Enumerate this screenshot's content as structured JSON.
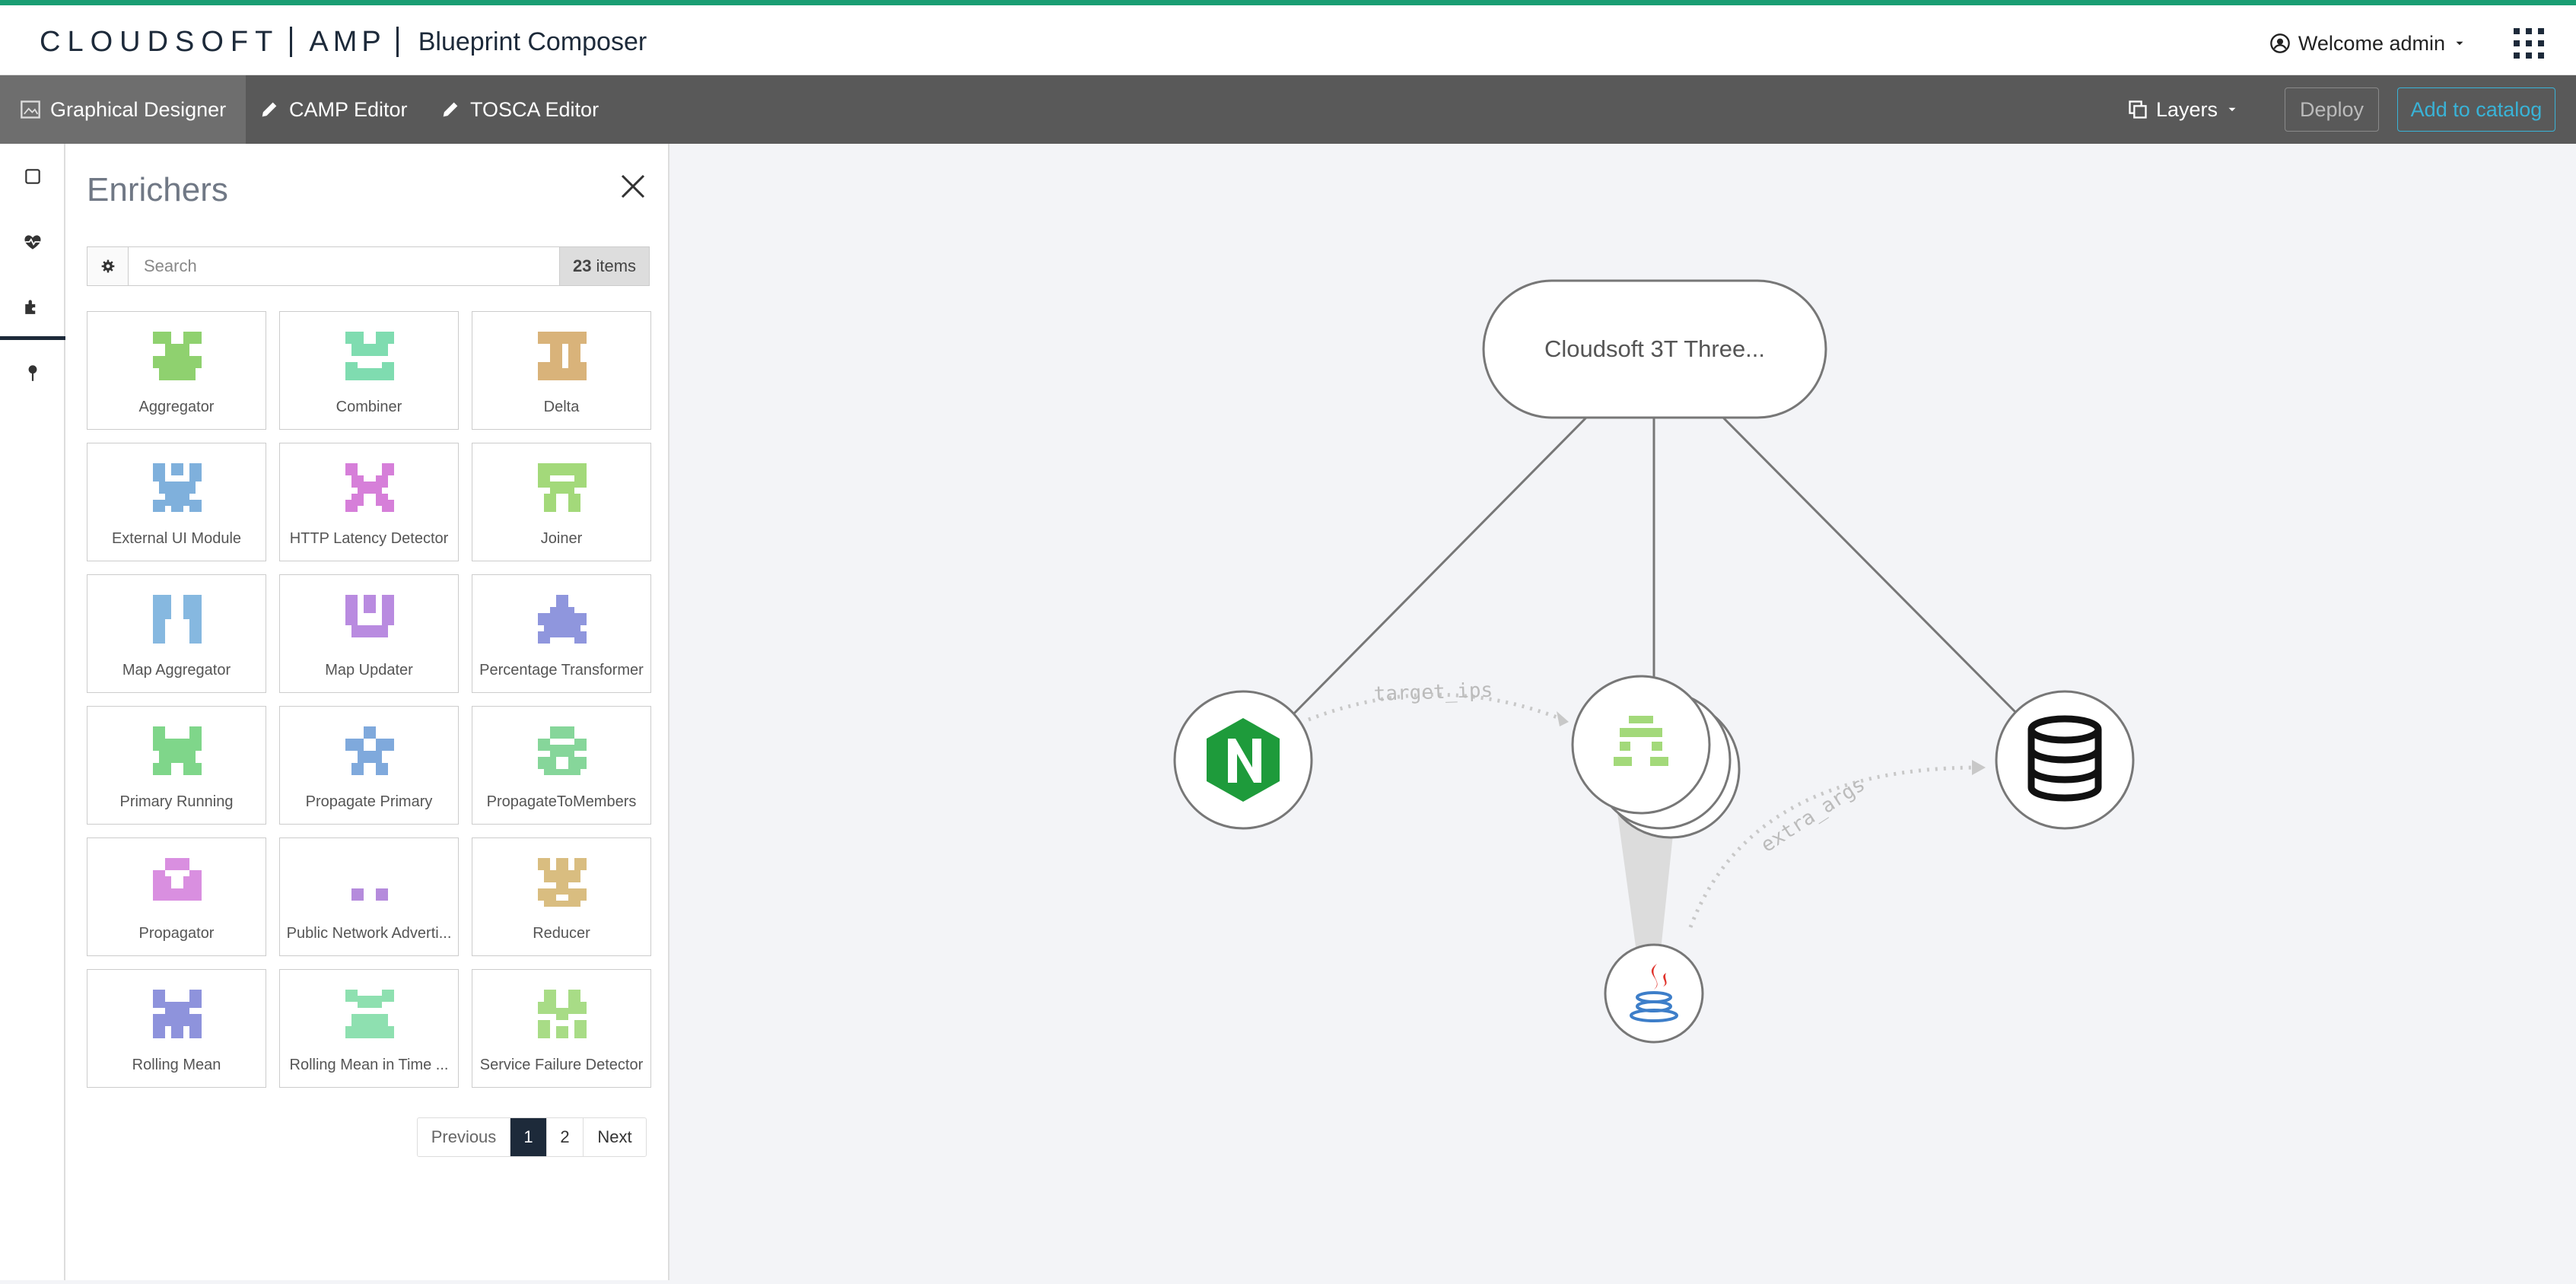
{
  "colors": {
    "accent_top": "#1a9e73",
    "brand_dark": "#1d2a3a",
    "toolbar_bg": "#595959",
    "catalog_blue": "#39b3d7",
    "nginx_green": "#1e9b3b"
  },
  "header": {
    "logo_brand": "CLOUDSOFT",
    "logo_product": "AMP",
    "title": "Blueprint Composer",
    "user_label": "Welcome admin",
    "user_icon": "user-circle-icon",
    "apps_icon": "apps-grid-icon"
  },
  "toolbar": {
    "tabs": [
      {
        "label": "Graphical Designer",
        "icon": "designer-icon",
        "active": true
      },
      {
        "label": "CAMP Editor",
        "icon": "pencil-icon",
        "active": false
      },
      {
        "label": "TOSCA Editor",
        "icon": "pencil-icon",
        "active": false
      }
    ],
    "layers_label": "Layers",
    "deploy_label": "Deploy",
    "catalog_label": "Add to catalog"
  },
  "rail": {
    "items": [
      "square-icon",
      "heartbeat-icon",
      "puzzle-icon",
      "pin-icon"
    ],
    "active_index": 2
  },
  "panel": {
    "title": "Enrichers",
    "search_placeholder": "Search",
    "count_number": "23",
    "count_suffix": "items",
    "items": [
      {
        "label": "Aggregator",
        "color": "#8fd16f"
      },
      {
        "label": "Combiner",
        "color": "#7fdcb0"
      },
      {
        "label": "Delta",
        "color": "#d9b37a"
      },
      {
        "label": "External UI Module",
        "color": "#7fb0dc"
      },
      {
        "label": "HTTP Latency Detector",
        "color": "#d67fd9"
      },
      {
        "label": "Joiner",
        "color": "#a3d97a"
      },
      {
        "label": "Map Aggregator",
        "color": "#86b8e0"
      },
      {
        "label": "Map Updater",
        "color": "#b98be0"
      },
      {
        "label": "Percentage Transformer",
        "color": "#8f96dd"
      },
      {
        "label": "Primary Running",
        "color": "#7fd68a"
      },
      {
        "label": "Propagate Primary",
        "color": "#7fa9dc"
      },
      {
        "label": "PropagateToMembers",
        "color": "#86d69a"
      },
      {
        "label": "Propagator",
        "color": "#d98fe0"
      },
      {
        "label": "Public Network Adverti...",
        "color": "#b58bdc"
      },
      {
        "label": "Reducer",
        "color": "#d9bd80"
      },
      {
        "label": "Rolling Mean",
        "color": "#8e93dc"
      },
      {
        "label": "Rolling Mean in Time ...",
        "color": "#8ee0b0"
      },
      {
        "label": "Service Failure Detector",
        "color": "#a8dc86"
      }
    ],
    "pagination": {
      "previous": "Previous",
      "pages": [
        "1",
        "2"
      ],
      "current": "1",
      "next": "Next"
    }
  },
  "canvas": {
    "root_label": "Cloudsoft 3T Three...",
    "edge_label_1": "target_ips",
    "edge_label_2": "extra_args",
    "nodes": [
      "nginx-icon",
      "cluster-icon",
      "database-icon",
      "java-icon"
    ]
  }
}
